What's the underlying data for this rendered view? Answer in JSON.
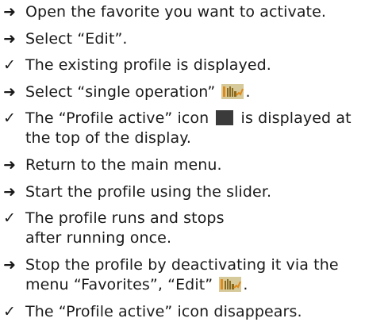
{
  "markers": {
    "action": "➜",
    "result": "✓"
  },
  "steps": [
    {
      "type": "action",
      "text": "Open the favorite you want to activate."
    },
    {
      "type": "action",
      "text": "Select “Edit”."
    },
    {
      "type": "result",
      "text": "The existing profile is displayed."
    },
    {
      "type": "action",
      "text_before": "Select “single operation” ",
      "icon": "single-operation-icon",
      "text_after": "."
    },
    {
      "type": "result",
      "text_before": "The “Profile active” icon ",
      "icon": "profile-active-icon",
      "text_after": " is displayed at the top of the display."
    },
    {
      "type": "action",
      "text": "Return to the main menu."
    },
    {
      "type": "action",
      "text": "Start the profile using the slider."
    },
    {
      "type": "result",
      "text": "The profile runs and stops after running once."
    },
    {
      "type": "action",
      "text_before": "Stop the profile by deactivating it via the menu “Favorites”, “Edit” ",
      "icon": "single-operation-icon",
      "text_after": "."
    },
    {
      "type": "result",
      "text": "The “Profile active” icon disappears."
    }
  ],
  "colors": {
    "icon_bg": "#d6c99a",
    "icon_dark": "#8b6a1e",
    "icon_accent": "#e08a1a",
    "profile_active_icon": "#3a3a3a"
  }
}
